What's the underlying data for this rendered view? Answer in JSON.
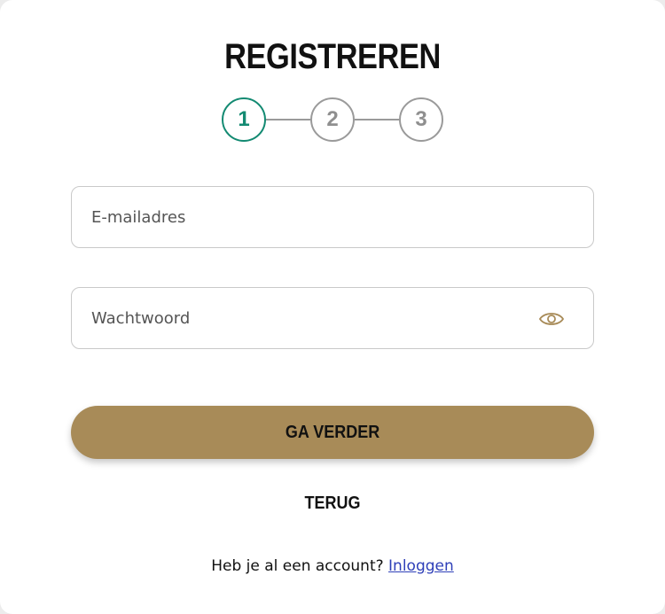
{
  "form": {
    "title": "REGISTREREN",
    "steps": [
      {
        "label": "1",
        "active": true
      },
      {
        "label": "2",
        "active": false
      },
      {
        "label": "3",
        "active": false
      }
    ],
    "email": {
      "placeholder": "E-mailadres",
      "value": ""
    },
    "password": {
      "placeholder": "Wachtwoord",
      "value": "",
      "toggle_icon": "eye-icon"
    },
    "continue_label": "GA VERDER",
    "back_label": "TERUG",
    "footer_text": "Heb je al een account?",
    "login_link": "Inloggen"
  },
  "colors": {
    "accent": "#a88b58",
    "step_active": "#138a72",
    "step_inactive": "#9a9a9a",
    "link": "#2e3fb8"
  }
}
